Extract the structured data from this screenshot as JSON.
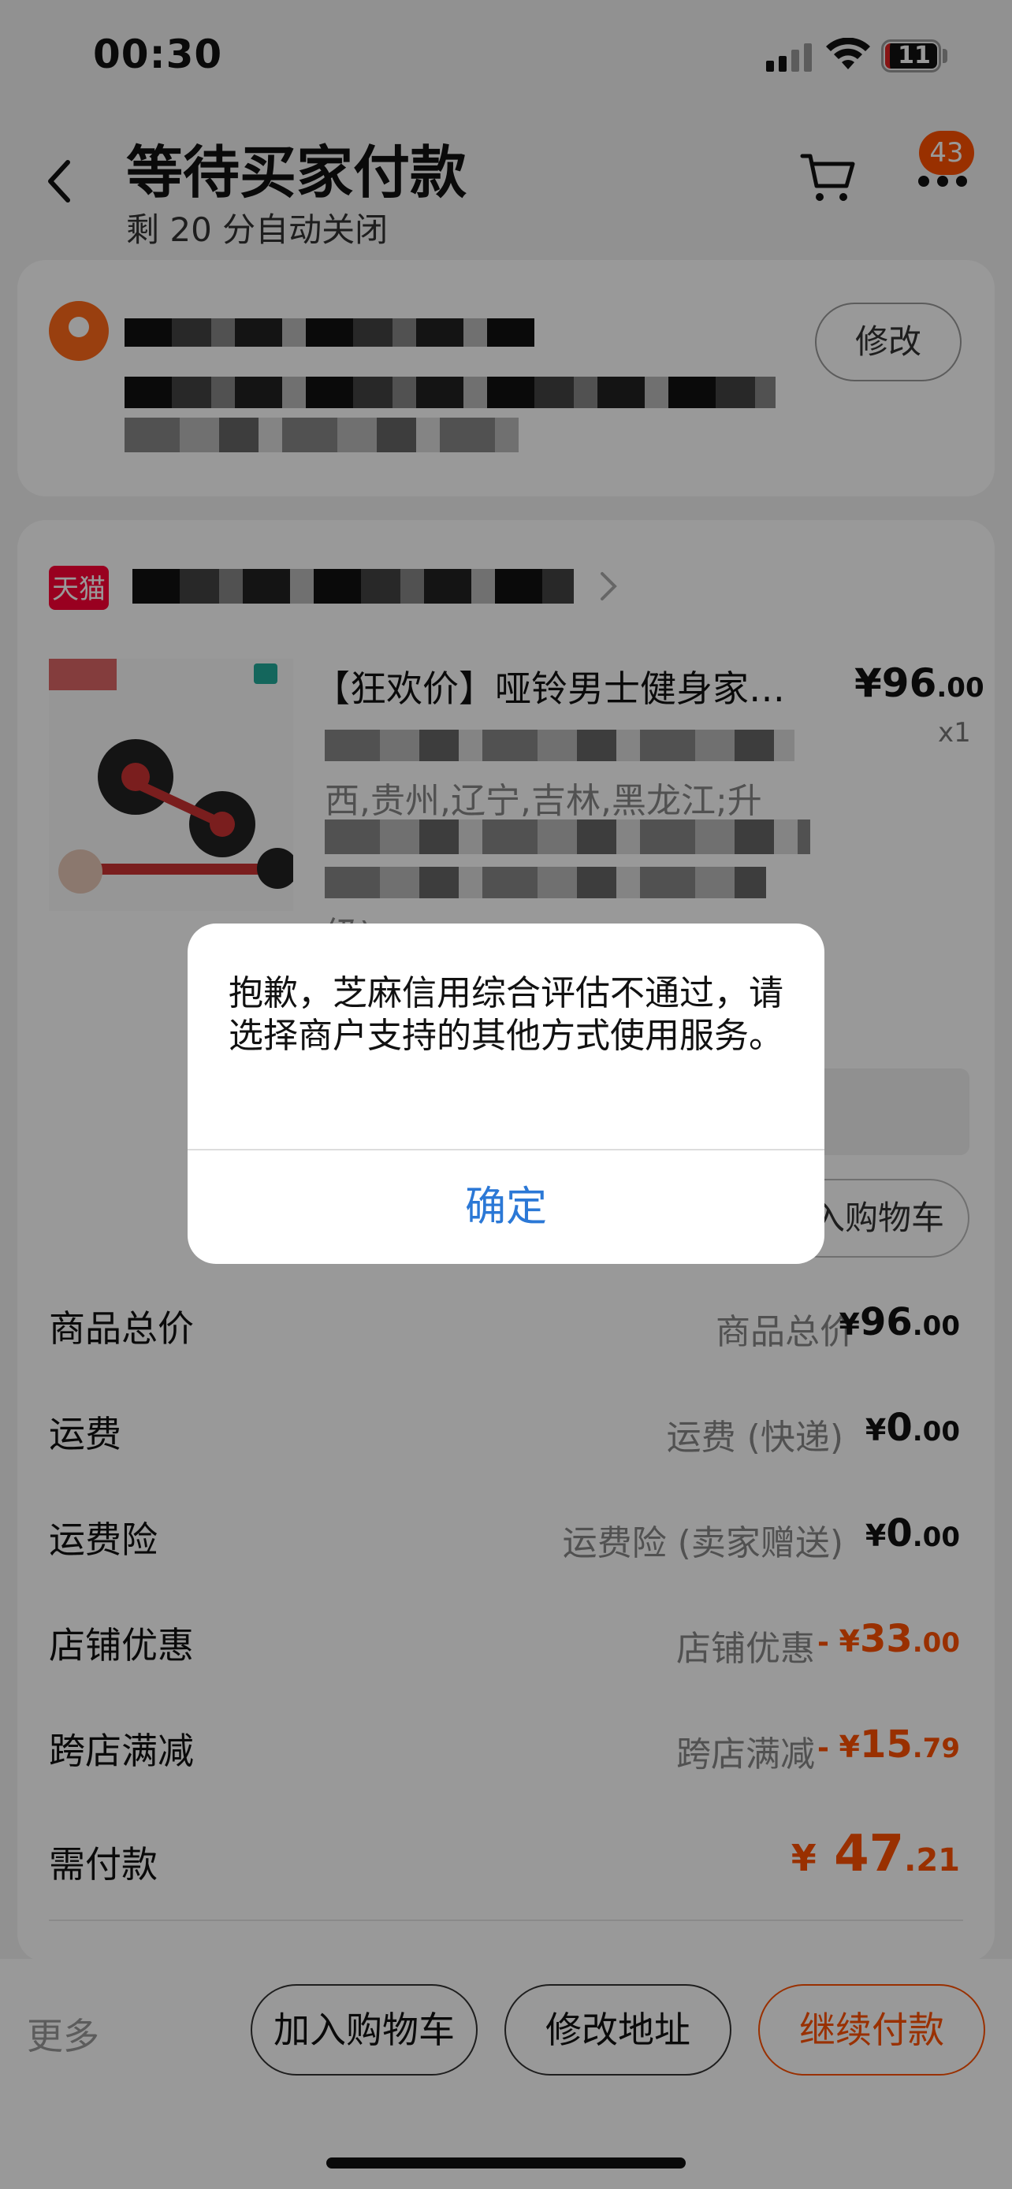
{
  "status_bar": {
    "time": "00:30",
    "battery": "11"
  },
  "header": {
    "title": "等待买家付款",
    "subtitle": "剩 20 分自动关闭",
    "badge_count": "43"
  },
  "address": {
    "edit_label": "修改"
  },
  "shop": {
    "logo_text": "天猫"
  },
  "product": {
    "title": "【狂欢价】哑铃男士健身家…",
    "price_currency": "¥",
    "price_int": "96",
    "price_dec": ".00",
    "qty": "x1",
    "spec_line": "西,贵州,辽宁,吉林,黑龙江;升",
    "spec_line_tail": "级)",
    "add_cart": "入购物车"
  },
  "summary": [
    {
      "label": "商品总价",
      "sub": "商品总价",
      "sign": "",
      "amount_int": "96",
      "amount_dec": ".00",
      "red": false
    },
    {
      "label": "运费",
      "sub": "运费 (快递)",
      "sign": "",
      "amount_int": "0",
      "amount_dec": ".00",
      "red": false
    },
    {
      "label": "运费险",
      "sub": "运费险 (卖家赠送)",
      "sign": "",
      "amount_int": "0",
      "amount_dec": ".00",
      "red": false
    },
    {
      "label": "店铺优惠",
      "sub": "店铺优惠",
      "sign": "- ",
      "amount_int": "33",
      "amount_dec": ".00",
      "red": true
    },
    {
      "label": "跨店满减",
      "sub": "跨店满减",
      "sign": "- ",
      "amount_int": "15",
      "amount_dec": ".79",
      "red": true
    }
  ],
  "pay": {
    "label": "需付款",
    "currency": "¥",
    "amount_int": "47",
    "amount_dec": ".21"
  },
  "bottom": {
    "more": "更多",
    "add_cart": "加入购物车",
    "edit_address": "修改地址",
    "continue_pay": "继续付款"
  },
  "dialog": {
    "message": "抱歉，芝麻信用综合评估不通过，请选择商户支持的其他方式使用服务。",
    "confirm": "确定"
  },
  "colors": {
    "accent": "#ff5000",
    "link": "#2b78d6"
  }
}
